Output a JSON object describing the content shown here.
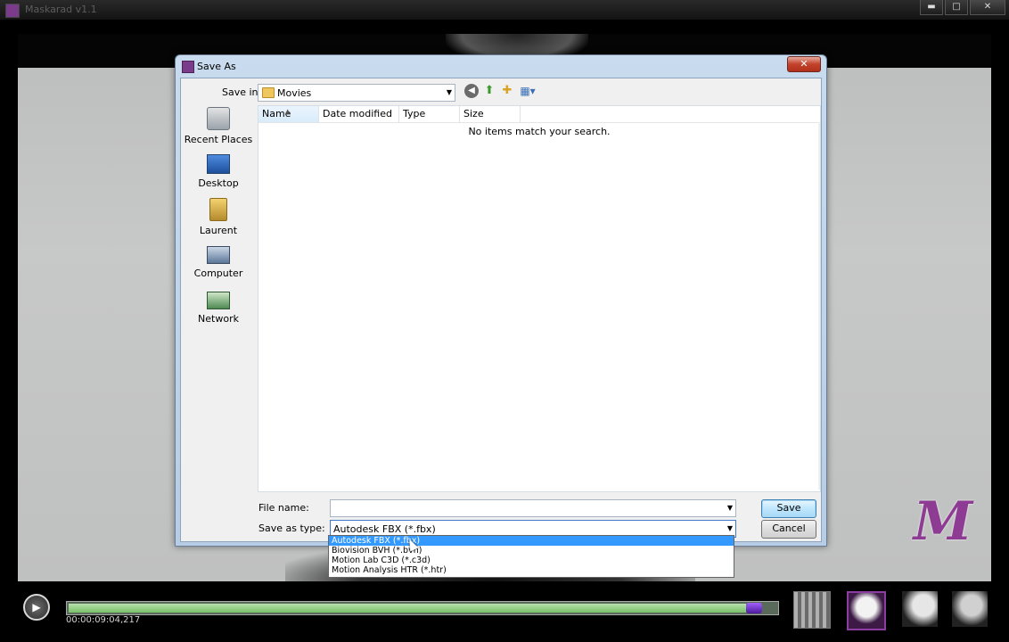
{
  "app": {
    "title": "Maskarad v1.1",
    "window_buttons": {
      "minimize": "▬",
      "maximize": "□",
      "close": "✕"
    }
  },
  "dialog": {
    "title": "Save As",
    "close_label": "✕",
    "save_in_label": "Save in:",
    "save_in_value": "Movies",
    "places": [
      {
        "label": "Recent Places",
        "icon": "recent-places-icon"
      },
      {
        "label": "Desktop",
        "icon": "desktop-icon"
      },
      {
        "label": "Laurent",
        "icon": "user-folder-icon"
      },
      {
        "label": "Computer",
        "icon": "computer-icon"
      },
      {
        "label": "Network",
        "icon": "network-icon"
      }
    ],
    "columns": [
      "Name",
      "Date modified",
      "Type",
      "Size"
    ],
    "empty_message": "No items match your search.",
    "file_name_label": "File name:",
    "file_name_value": "",
    "save_as_type_label": "Save as type:",
    "save_as_type_value": "Autodesk FBX (*.fbx)",
    "type_options": [
      "Autodesk FBX (*.fbx)",
      "Biovision BVH (*.bvh)",
      "Motion Lab C3D (*.c3d)",
      "Motion Analysis HTR (*.htr)"
    ],
    "selected_option_index": 0,
    "save_button": "Save",
    "cancel_button": "Cancel"
  },
  "player": {
    "timecode": "00:00:09:04,217",
    "progress": 0.98
  },
  "logo": {
    "letter": "M"
  },
  "colors": {
    "accent_purple": "#8e3b93",
    "selection_blue": "#3399ff",
    "timeline_green": "#78c067"
  }
}
